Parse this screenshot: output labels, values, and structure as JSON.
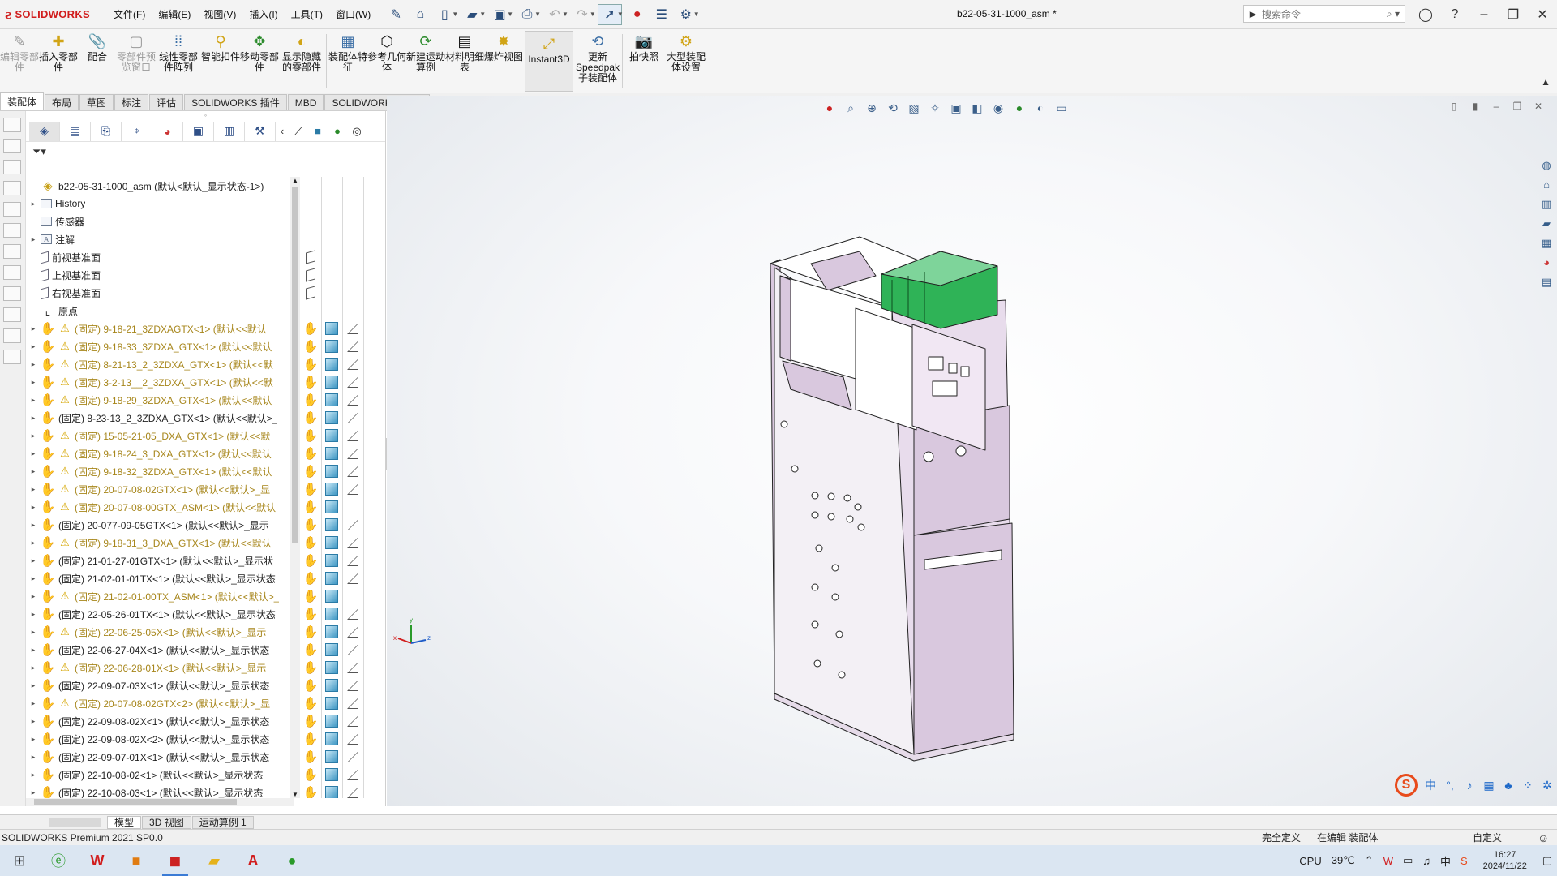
{
  "app": {
    "logo_ds": "ƨ",
    "logo_name": "SOLIDWORKS",
    "document_title": "b22-05-31-1000_asm *"
  },
  "menu": [
    "文件(F)",
    "编辑(E)",
    "视图(V)",
    "插入(I)",
    "工具(T)",
    "窗口(W)"
  ],
  "search": {
    "placeholder": "搜索命令"
  },
  "commands": [
    {
      "label": "编辑零部件",
      "icon": "edit-component-icon",
      "disabled": true
    },
    {
      "label": "插入零部件",
      "icon": "insert-component-icon",
      "disabled": false
    },
    {
      "label": "配合",
      "icon": "mate-icon",
      "disabled": false
    },
    {
      "label": "零部件预览窗口",
      "icon": "component-preview-icon",
      "disabled": true
    },
    {
      "label": "线性零部件阵列",
      "icon": "linear-pattern-icon",
      "disabled": false
    },
    {
      "label": "智能扣件",
      "icon": "smart-fasteners-icon",
      "disabled": false
    },
    {
      "label": "移动零部件",
      "icon": "move-component-icon",
      "disabled": false
    },
    {
      "label": "显示隐藏的零部件",
      "icon": "show-hidden-icon",
      "disabled": false
    },
    {
      "label": "装配体特征",
      "icon": "assembly-features-icon",
      "disabled": false
    },
    {
      "label": "参考几何体",
      "icon": "reference-geometry-icon",
      "disabled": false
    },
    {
      "label": "新建运动算例",
      "icon": "new-motion-study-icon",
      "disabled": false
    },
    {
      "label": "材料明细表",
      "icon": "bom-icon",
      "disabled": false
    },
    {
      "label": "爆炸视图",
      "icon": "exploded-view-icon",
      "disabled": false
    },
    {
      "label": "Instant3D",
      "icon": "instant3d-icon",
      "disabled": false
    },
    {
      "label": "更新Speedpak子装配体",
      "icon": "speedpak-icon",
      "disabled": false
    },
    {
      "label": "拍快照",
      "icon": "snapshot-icon",
      "disabled": false
    },
    {
      "label": "大型装配体设置",
      "icon": "large-assembly-icon",
      "disabled": false
    }
  ],
  "tabs": [
    "装配体",
    "布局",
    "草图",
    "标注",
    "评估",
    "SOLIDWORKS 插件",
    "MBD",
    "SOLIDWORKS CAM"
  ],
  "tree": {
    "root": "b22-05-31-1000_asm  (默认<默认_显示状态-1>)",
    "items": [
      {
        "label": "History",
        "kind": "folder",
        "exp": "▸",
        "icon": "history-icon"
      },
      {
        "label": "传感器",
        "kind": "folder",
        "exp": "",
        "icon": "sensor-icon"
      },
      {
        "label": "注解",
        "kind": "folder",
        "exp": "▸",
        "icon": "annotation-icon"
      },
      {
        "label": "前视基准面",
        "kind": "plane",
        "exp": "",
        "icon": "plane-icon"
      },
      {
        "label": "上视基准面",
        "kind": "plane",
        "exp": "",
        "icon": "plane-icon"
      },
      {
        "label": "右视基准面",
        "kind": "plane",
        "exp": "",
        "icon": "plane-icon"
      },
      {
        "label": "原点",
        "kind": "origin",
        "exp": "",
        "icon": "origin-icon"
      },
      {
        "label": "(固定) 9-18-21_3ZDXAGTX<1> (默认<<默认",
        "kind": "part",
        "warn": true
      },
      {
        "label": "(固定) 9-18-33_3ZDXA_GTX<1> (默认<<默认",
        "kind": "part",
        "warn": true
      },
      {
        "label": "(固定) 8-21-13_2_3ZDXA_GTX<1> (默认<<默",
        "kind": "part",
        "warn": true
      },
      {
        "label": "(固定) 3-2-13__2_3ZDXA_GTX<1> (默认<<默",
        "kind": "part",
        "warn": true
      },
      {
        "label": "(固定) 9-18-29_3ZDXA_GTX<1> (默认<<默认",
        "kind": "part",
        "warn": true
      },
      {
        "label": "(固定) 8-23-13_2_3ZDXA_GTX<1> (默认<<默认>_",
        "kind": "part",
        "warn": false
      },
      {
        "label": "(固定) 15-05-21-05_DXA_GTX<1> (默认<<默",
        "kind": "part",
        "warn": true
      },
      {
        "label": "(固定) 9-18-24_3_DXA_GTX<1> (默认<<默认",
        "kind": "part",
        "warn": true
      },
      {
        "label": "(固定) 9-18-32_3ZDXA_GTX<1> (默认<<默认",
        "kind": "part",
        "warn": true
      },
      {
        "label": "(固定) 20-07-08-02GTX<1> (默认<<默认>_显",
        "kind": "part",
        "warn": true
      },
      {
        "label": "(固定) 20-07-08-00GTX_ASM<1> (默认<<默认",
        "kind": "asm",
        "warn": true
      },
      {
        "label": "(固定) 20-077-09-05GTX<1> (默认<<默认>_显示",
        "kind": "part",
        "warn": false
      },
      {
        "label": "(固定) 9-18-31_3_DXA_GTX<1> (默认<<默认",
        "kind": "part",
        "warn": true
      },
      {
        "label": "(固定) 21-01-27-01GTX<1> (默认<<默认>_显示状",
        "kind": "part",
        "warn": false
      },
      {
        "label": "(固定) 21-02-01-01TX<1> (默认<<默认>_显示状态",
        "kind": "part",
        "warn": false
      },
      {
        "label": "(固定) 21-02-01-00TX_ASM<1> (默认<<默认>_",
        "kind": "asm",
        "warn": true
      },
      {
        "label": "(固定) 22-05-26-01TX<1> (默认<<默认>_显示状态",
        "kind": "part",
        "warn": false
      },
      {
        "label": "(固定) 22-06-25-05X<1> (默认<<默认>_显示",
        "kind": "part",
        "warn": true
      },
      {
        "label": "(固定) 22-06-27-04X<1> (默认<<默认>_显示状态",
        "kind": "part",
        "warn": false
      },
      {
        "label": "(固定) 22-06-28-01X<1> (默认<<默认>_显示",
        "kind": "part",
        "warn": true
      },
      {
        "label": "(固定) 22-09-07-03X<1> (默认<<默认>_显示状态",
        "kind": "part",
        "warn": false
      },
      {
        "label": "(固定) 20-07-08-02GTX<2> (默认<<默认>_显",
        "kind": "part",
        "warn": true
      },
      {
        "label": "(固定) 22-09-08-02X<1> (默认<<默认>_显示状态",
        "kind": "part",
        "warn": false
      },
      {
        "label": "(固定) 22-09-08-02X<2> (默认<<默认>_显示状态",
        "kind": "part",
        "warn": false
      },
      {
        "label": "(固定) 22-09-07-01X<1> (默认<<默认>_显示状态",
        "kind": "part",
        "warn": false
      },
      {
        "label": "(固定) 22-10-08-02<1> (默认<<默认>_显示状态",
        "kind": "part",
        "warn": false
      },
      {
        "label": "(固定) 22-10-08-03<1> (默认<<默认>_显示状态",
        "kind": "part",
        "warn": false
      }
    ]
  },
  "bottom_tabs": [
    "模型",
    "3D 视图",
    "运动算例 1"
  ],
  "status": {
    "product": "SOLIDWORKS Premium 2021 SP0.0",
    "def": "完全定义",
    "editing": "在编辑 装配体",
    "custom": "自定义"
  },
  "taskbar": {
    "cpu": "CPU",
    "temp": "39℃",
    "time": "16:27",
    "date": "2024/11/22"
  },
  "ime": {
    "s": "S",
    "zh": "中"
  },
  "colors": {
    "logo_red": "#d11d1d",
    "cabinet_pink": "#dccbe0",
    "pcb_green": "#22a34a",
    "warning_yellow": "#d6a600",
    "accent_blue": "#3a7bd5"
  }
}
